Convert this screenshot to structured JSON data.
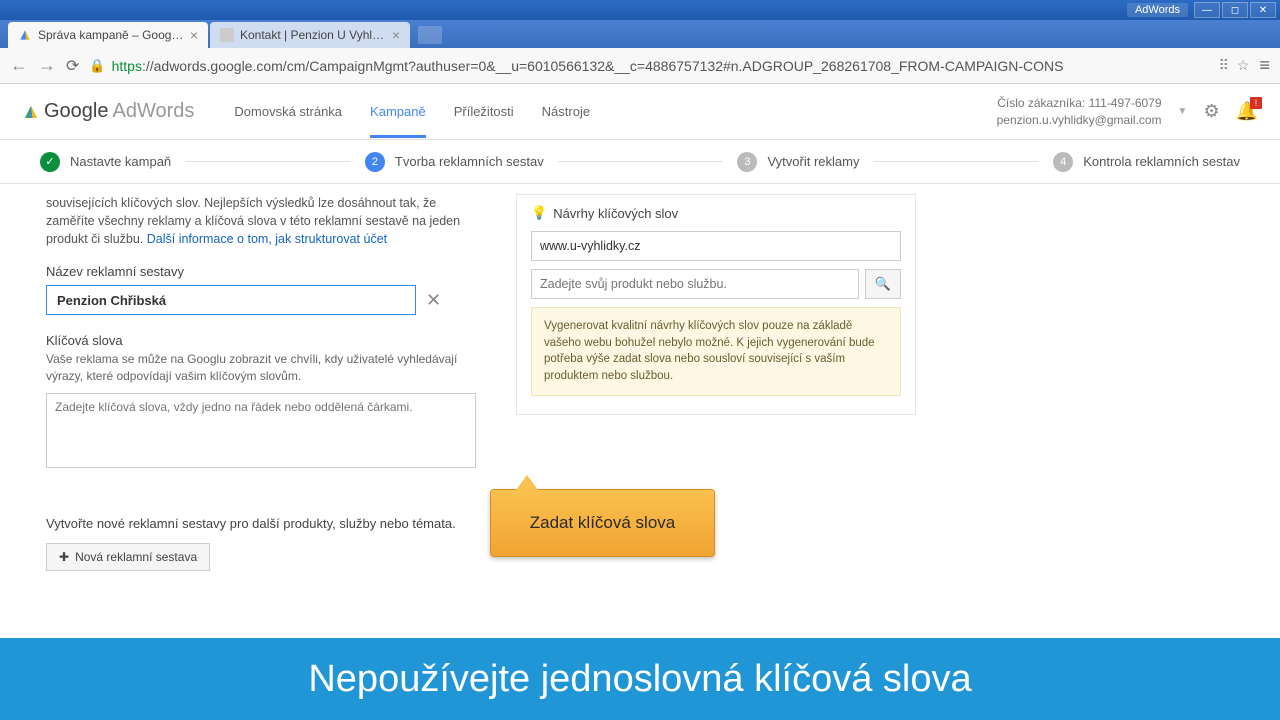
{
  "window": {
    "app_label": "AdWords"
  },
  "tabs": [
    {
      "title": "Správa kampaně – Google A"
    },
    {
      "title": "Kontakt | Penzion U Vyhlídk"
    }
  ],
  "url": {
    "https": "https",
    "rest": "://adwords.google.com/cm/CampaignMgmt?authuser=0&__u=6010566132&__c=4886757132#n.ADGROUP_268261708_FROM-CAMPAIGN-CONS"
  },
  "aw": {
    "logo_google": "Google",
    "logo_adwords": "AdWords",
    "nav": {
      "home": "Domovská stránka",
      "campaigns": "Kampaně",
      "opportunities": "Příležitosti",
      "tools": "Nástroje"
    },
    "account": {
      "line1": "Číslo zákazníka: 111-497-6079",
      "line2": "penzion.u.vyhlidky@gmail.com"
    },
    "bell_badge": "!"
  },
  "steps": {
    "s1": "Nastavte kampaň",
    "s2": "Tvorba reklamních sestav",
    "s3": "Vytvořit reklamy",
    "s4": "Kontrola reklamních sestav"
  },
  "left": {
    "intro": "souvisejících klíčových slov. Nejlepších výsledků lze dosáhnout tak, že zaměříte všechny reklamy a klíčová slova v této reklamní sestavě na jeden produkt či službu. ",
    "intro_link": "Další informace o tom, jak strukturovat účet",
    "group_label": "Název reklamní sestavy",
    "group_value": "Penzion Chřibská",
    "kw_label": "Klíčová slova",
    "kw_help": "Vaše reklama se může na Googlu zobrazit ve chvíli, kdy uživatelé vyhledávají výrazy, které odpovídají vašim klíčovým slovům.",
    "kw_placeholder": "Zadejte klíčová slova, vždy jedno na řádek nebo oddělená čárkami.",
    "create_more": "Vytvořte nové reklamní sestavy pro další produkty, služby nebo témata.",
    "new_group_btn": "Nová reklamní sestava"
  },
  "right": {
    "title": "Návrhy klíčových slov",
    "url_value": "www.u-vyhlidky.cz",
    "product_placeholder": "Zadejte svůj produkt nebo službu.",
    "warning": "Vygenerovat kvalitní návrhy klíčových slov pouze na základě vašeho webu bohužel nebylo možné. K jejich vygenerování bude potřeba výše zadat slova nebo sousloví související s vaším produktem nebo službou."
  },
  "callout": "Zadat klíčová slova",
  "banner": "Nepoužívejte jednoslovná klíčová slova"
}
